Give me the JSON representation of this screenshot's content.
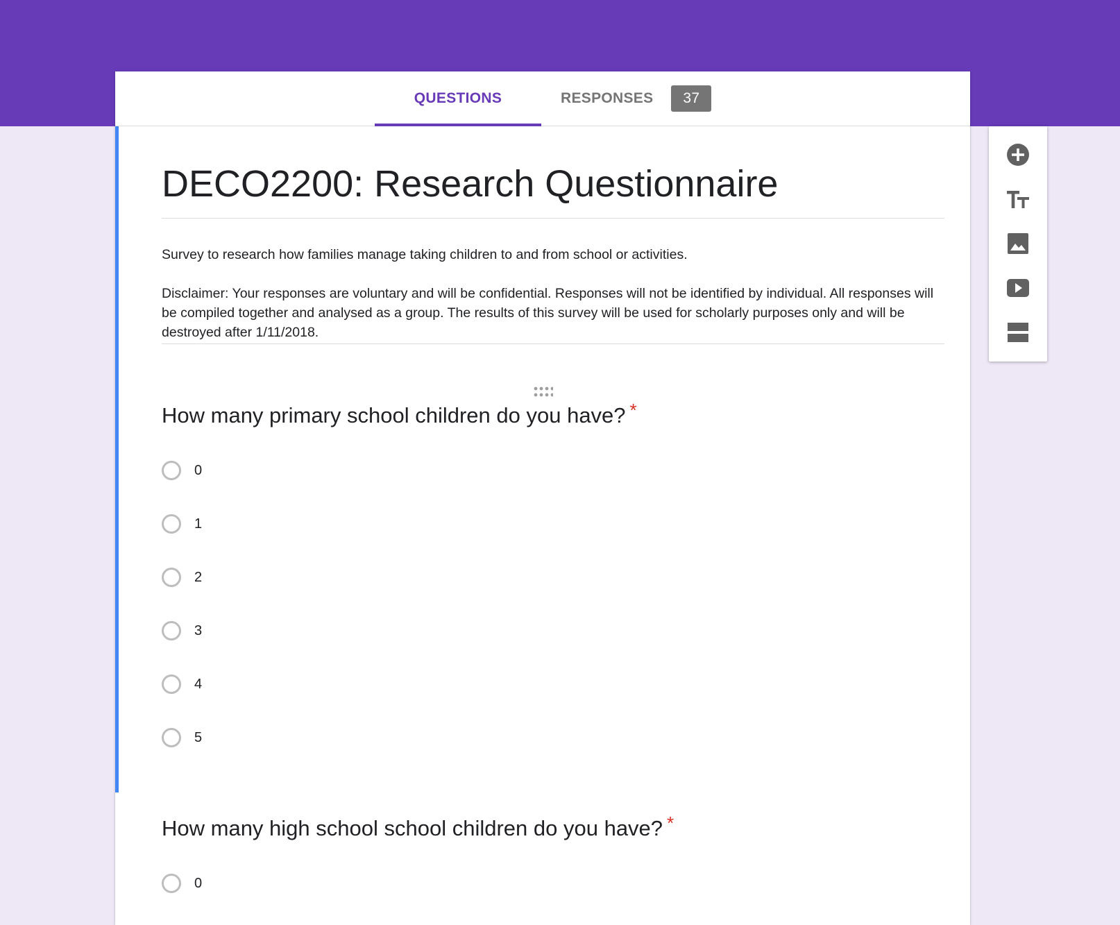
{
  "tabs": {
    "questions_label": "QUESTIONS",
    "responses_label": "RESPONSES",
    "responses_count": "37"
  },
  "form": {
    "title": "DECO2200: Research Questionnaire",
    "description": "Survey to research how families manage taking children to and from school or activities.",
    "disclaimer": "Disclaimer: Your responses are voluntary and will be confidential. Responses will not be identified by individual. All responses will be compiled together and analysed as a group. The results of this survey will be used for scholarly purposes only and will be destroyed after 1/11/2018."
  },
  "questions": [
    {
      "title": "How many primary school children do you have?",
      "required_mark": "*",
      "options": [
        "0",
        "1",
        "2",
        "3",
        "4",
        "5"
      ]
    },
    {
      "title": "How many high school school children do you have?",
      "required_mark": "*",
      "options": [
        "0"
      ]
    }
  ],
  "toolbar": {
    "buttons": [
      "add-question-icon",
      "add-title-icon",
      "add-image-icon",
      "add-video-icon",
      "add-section-icon"
    ]
  },
  "colors": {
    "header": "#673ab7",
    "background": "#ede7f6",
    "accent": "#4285f4",
    "required": "#d93025",
    "badge": "#757575"
  }
}
